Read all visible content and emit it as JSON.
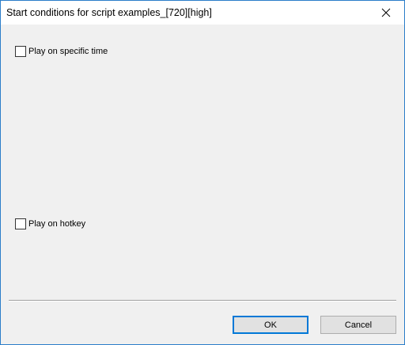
{
  "window": {
    "title": "Start conditions for script examples_[720][high]",
    "close_icon": "close-icon"
  },
  "options": {
    "specific_time": {
      "label": "Play on specific time",
      "checked": false
    },
    "hotkey": {
      "label": "Play on hotkey",
      "checked": false
    }
  },
  "buttons": {
    "ok_label": "OK",
    "cancel_label": "Cancel"
  },
  "colors": {
    "window_border": "#2b7dc9",
    "client_background": "#f0f0f0",
    "default_button_accent": "#0078d7"
  }
}
